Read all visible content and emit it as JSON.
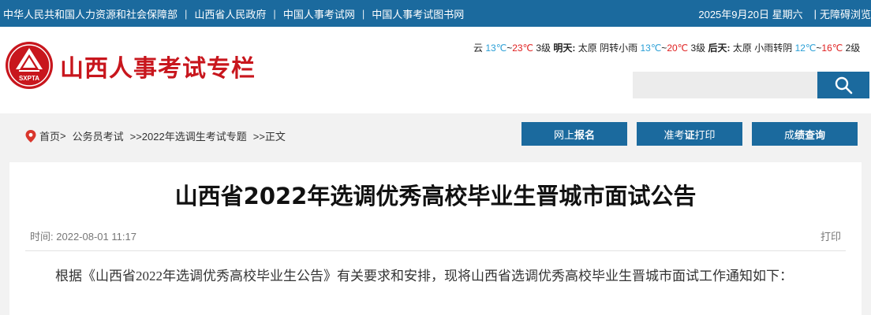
{
  "topbar": {
    "links": [
      "中华人民共和国人力资源和社会保障部",
      "山西省人民政府",
      "中国人事考试网",
      "中国人事考试图书网"
    ],
    "separator": "|",
    "date": "2025年9月20日  星期六",
    "accessibility": "无障碍浏览"
  },
  "header": {
    "logo_text": "SXPTA",
    "site_title": "山西人事考试专栏",
    "weather": {
      "today": {
        "desc": "云",
        "low": "13℃",
        "tilde": "~",
        "high": "23℃",
        "wind": "3级"
      },
      "tomorrow": {
        "label": "明天:",
        "city": "太原",
        "desc": "阴转小雨",
        "low": "13℃",
        "tilde": "~",
        "high": "20℃",
        "wind": "3级"
      },
      "dayafter": {
        "label": "后天:",
        "city": "太原",
        "desc": "小雨转阴",
        "low": "12℃",
        "tilde": "~",
        "high": "16℃",
        "wind": "2级"
      }
    },
    "search": {
      "placeholder": "",
      "icon": "search-icon"
    }
  },
  "breadcrumb": {
    "icon": "location-pin-icon",
    "home": "首页",
    "home_sep": ">",
    "item1": "公务员考试",
    "item2": ">>2022年选调生考试专题",
    "item3": ">>正文"
  },
  "nav_buttons": {
    "register": {
      "pre": "网上",
      "bold": "报名",
      "post": ""
    },
    "admit": {
      "pre": "准考",
      "bold": "证",
      "post": "打印"
    },
    "score": {
      "pre": "成",
      "bold": "绩查询",
      "post": ""
    }
  },
  "article": {
    "title": "山西省2022年选调优秀高校毕业生晋城市面试公告",
    "time_label": "时间:",
    "time_value": "2022-08-01 11:17",
    "print_label": "打印",
    "paragraph": "根据《山西省2022年选调优秀高校毕业生公告》有关要求和安排，现将山西省选调优秀高校毕业生晋城市面试工作通知如下："
  },
  "colors": {
    "primary": "#1b6a9e",
    "brand_red": "#c8161d",
    "temp_low": "#2a9fd6",
    "temp_high": "#e02020"
  }
}
